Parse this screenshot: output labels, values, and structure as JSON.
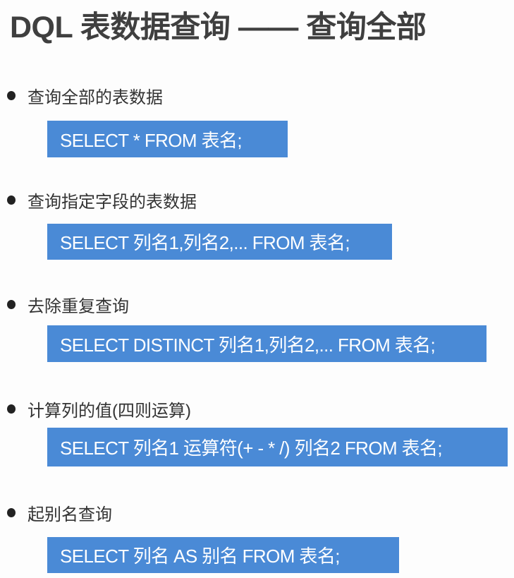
{
  "title": "DQL 表数据查询 —— 查询全部",
  "items": [
    {
      "label": "查询全部的表数据",
      "code": "SELECT * FROM 表名;"
    },
    {
      "label": "查询指定字段的表数据",
      "code": "SELECT 列名1,列名2,... FROM 表名;"
    },
    {
      "label": "去除重复查询",
      "code": "SELECT DISTINCT 列名1,列名2,... FROM 表名;"
    },
    {
      "label": "计算列的值(四则运算)",
      "code": "SELECT 列名1 运算符(+ - * /) 列名2 FROM 表名;"
    },
    {
      "label": "起别名查询",
      "code": "SELECT 列名 AS 别名 FROM 表名;"
    }
  ],
  "colors": {
    "code_background": "#4a8ad6",
    "title": "#3f3f3f"
  }
}
